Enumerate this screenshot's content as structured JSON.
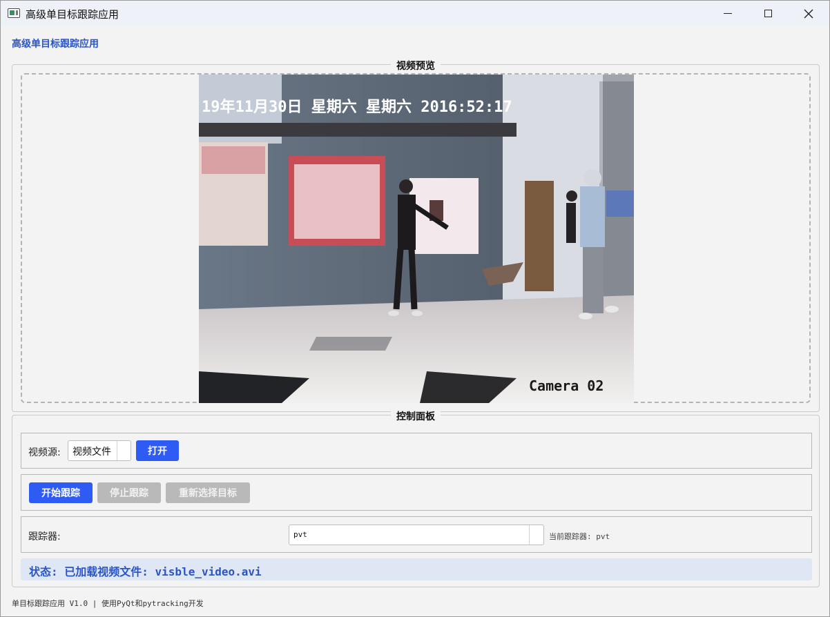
{
  "window": {
    "title": "高级单目标跟踪应用"
  },
  "header": {
    "title": "高级单目标跟踪应用"
  },
  "preview": {
    "group_title": "视频预览",
    "overlay_timestamp": "19年11月30日 星期六 星期六 2016:52:17",
    "overlay_camera": "Camera 02"
  },
  "control": {
    "group_title": "控制面板",
    "source_label": "视频源:",
    "source_value": "视频文件",
    "open_button": "打开",
    "start_button": "开始跟踪",
    "stop_button": "停止跟踪",
    "reselect_button": "重新选择目标",
    "tracker_label": "跟踪器:",
    "tracker_value": "pvt",
    "current_tracker": "当前跟踪器: pvt",
    "status": "状态: 已加载视频文件: visble_video.avi"
  },
  "footer": {
    "text": "单目标跟踪应用 V1.0 | 使用PyQt和pytracking开发"
  },
  "colors": {
    "accent": "#2f5bf5",
    "title_blue": "#2a55c8",
    "disabled": "#b9b9b9",
    "status_bg": "#dfe6f4"
  }
}
